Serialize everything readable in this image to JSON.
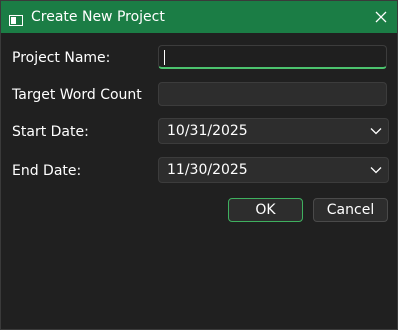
{
  "window": {
    "title": "Create New Project",
    "icon": "window-app-icon",
    "accent_color": "#1b7d45"
  },
  "form": {
    "project_name": {
      "label": "Project Name:",
      "value": ""
    },
    "target_word_count": {
      "label": "Target Word Count",
      "value": ""
    },
    "start_date": {
      "label": "Start Date:",
      "value": "10/31/2025"
    },
    "end_date": {
      "label": "End Date:",
      "value": "11/30/2025"
    }
  },
  "buttons": {
    "ok_label": "OK",
    "cancel_label": "Cancel"
  }
}
